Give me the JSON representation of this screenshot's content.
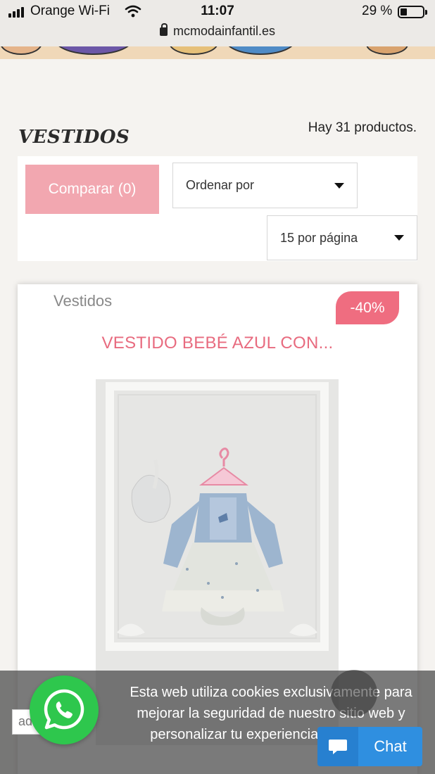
{
  "status_bar": {
    "carrier": "Orange Wi-Fi",
    "time": "11:07",
    "battery_percent": "29 %",
    "battery_level": 0.29,
    "url": "mcmodainfantil.es"
  },
  "category": {
    "title": "VESTIDOS",
    "product_count": "Hay 31 productos."
  },
  "toolbar": {
    "compare_label": "Comparar (0)",
    "sort_label": "Ordenar por",
    "per_page_label": "15 por página"
  },
  "product": {
    "category": "Vestidos",
    "discount": "-40%",
    "name": "VESTIDO BEBÉ AZUL CON..."
  },
  "cookie_banner": {
    "text": "Esta web utiliza cookies exclusivamente para mejorar la seguridad de nuestro sitio web y personalizar tu experiencia de usuario."
  },
  "search_stub": "ad",
  "chat": {
    "label": "Chat"
  },
  "colors": {
    "accent_pink": "#f2a7b0",
    "badge_pink": "#ef6d80",
    "whatsapp_green": "#2ec74d",
    "chat_blue": "#2f8fe0"
  },
  "icons": [
    "signal-icon",
    "wifi-icon",
    "lock-icon",
    "battery-icon",
    "caret-down-icon",
    "whatsapp-icon",
    "chat-bubble-icon"
  ]
}
